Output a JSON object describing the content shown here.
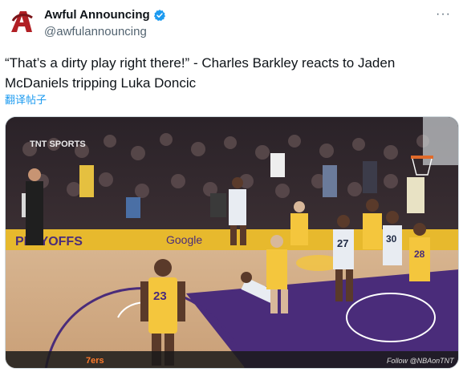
{
  "account": {
    "display_name": "Awful Announcing",
    "handle": "@awfulannouncing",
    "verified": true,
    "avatar_icon": "awful-announcing-logo-icon",
    "avatar_color": "#b11f24"
  },
  "menu": {
    "more_label": "···"
  },
  "tweet": {
    "text": "“That’s a dirty play right there!” - Charles Barkley reacts to Jaden McDaniels tripping Luka Doncic",
    "translate_label": "翻译帖子"
  },
  "media": {
    "broadcaster_logo": "TNT SPORTS",
    "court_banner": "PLAYOFFS",
    "court_logo": "Google",
    "credit": "Follow @NBAonTNT",
    "score_tag": "7ers",
    "jersey_numbers": [
      "23",
      "27",
      "30",
      "28"
    ],
    "colors": {
      "lakers_gold": "#f4c63d",
      "court_purple": "#4a2c7a",
      "wolves_white": "#e8ecf2"
    }
  }
}
